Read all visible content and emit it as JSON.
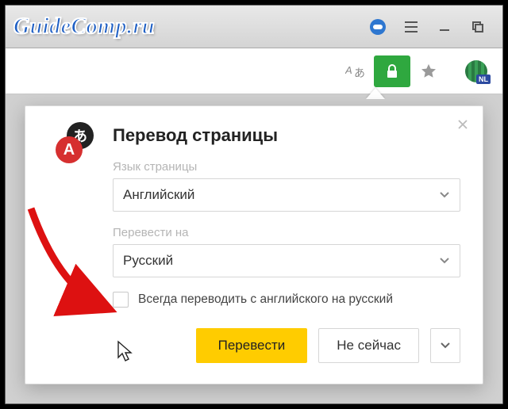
{
  "site_title": "GuideComp.ru",
  "titlebar": {
    "menu_tip": "Меню",
    "minimize_tip": "Свернуть",
    "maximize_tip": "Развернуть"
  },
  "toolbar": {
    "translate_tip": "Перевести",
    "lock_tip": "Защищённое соединение",
    "bookmark_tip": "Закладка",
    "ext_badge": "NL"
  },
  "popup": {
    "heading": "Перевод страницы",
    "close_tip": "Закрыть",
    "src_label": "Язык страницы",
    "src_value": "Английский",
    "dst_label": "Перевести на",
    "dst_value": "Русский",
    "always_label": "Всегда переводить с английского на русский",
    "btn_translate": "Перевести",
    "btn_later": "Не сейчас"
  },
  "icons": {
    "ti_back_glyph": "あ",
    "ti_front_glyph": "А"
  }
}
